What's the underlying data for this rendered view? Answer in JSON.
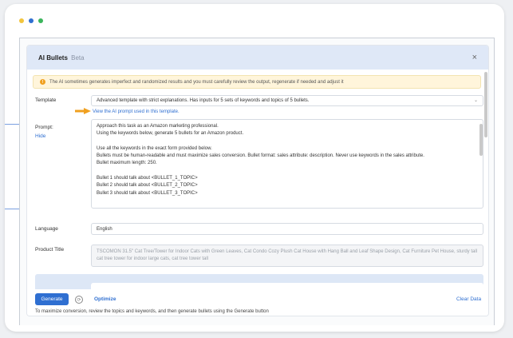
{
  "window": {
    "dot_colors": [
      "#f2c53d",
      "#2f6fd1",
      "#3bb55c"
    ]
  },
  "modal": {
    "title": "AI Bullets",
    "badge": "Beta",
    "close_icon": "×"
  },
  "notice": {
    "icon": "!",
    "text": "The AI sometimes generates imperfect and randomized results and you must carefully review the output, regenerate if needed and adjust it"
  },
  "template": {
    "label": "Template",
    "value": "Advanced template with strict explanations. Has inputs for 5 sets of keywords and topics of 5 bullets.",
    "link": "View the AI prompt used in this template."
  },
  "prompt": {
    "label": "Prompt:",
    "hide": "Hide",
    "lines": [
      "Approach this task as an Amazon marketing professional.",
      "Using the keywords below, generate 5 bullets for an Amazon product.",
      "",
      "Use all the keywords in the exact form provided below.",
      "Bullets must be human-readable and must maximize sales conversion. Bullet format: sales attribute: description. Never use keywords in the sales attribute.",
      "Bullet maximum length: 250.",
      "",
      "Bullet 1 should talk about <BULLET_1_TOPIC>",
      "Bullet 2 should talk about <BULLET_2_TOPIC>",
      "Bullet 3 should talk about <BULLET_3_TOPIC>"
    ]
  },
  "language": {
    "label": "Language",
    "value": "English"
  },
  "product_title": {
    "label": "Product Title",
    "value": "TSCOMON 31.5\" Cat Tree/Tower for Indoor Cats with Green Leaves, Cat Condo Cozy Plush Cat House with Hang Ball and Leaf Shape Design, Cat Furniture Pet House, sturdy tall cat tree tower for indoor large cats, cat tree tower tall"
  },
  "footer": {
    "generate": "Generate",
    "optimize": "Optimize",
    "clear": "Clear Data",
    "note": "To maximize conversion, review the topics and keywords, and then generate bullets using the Generate button"
  }
}
